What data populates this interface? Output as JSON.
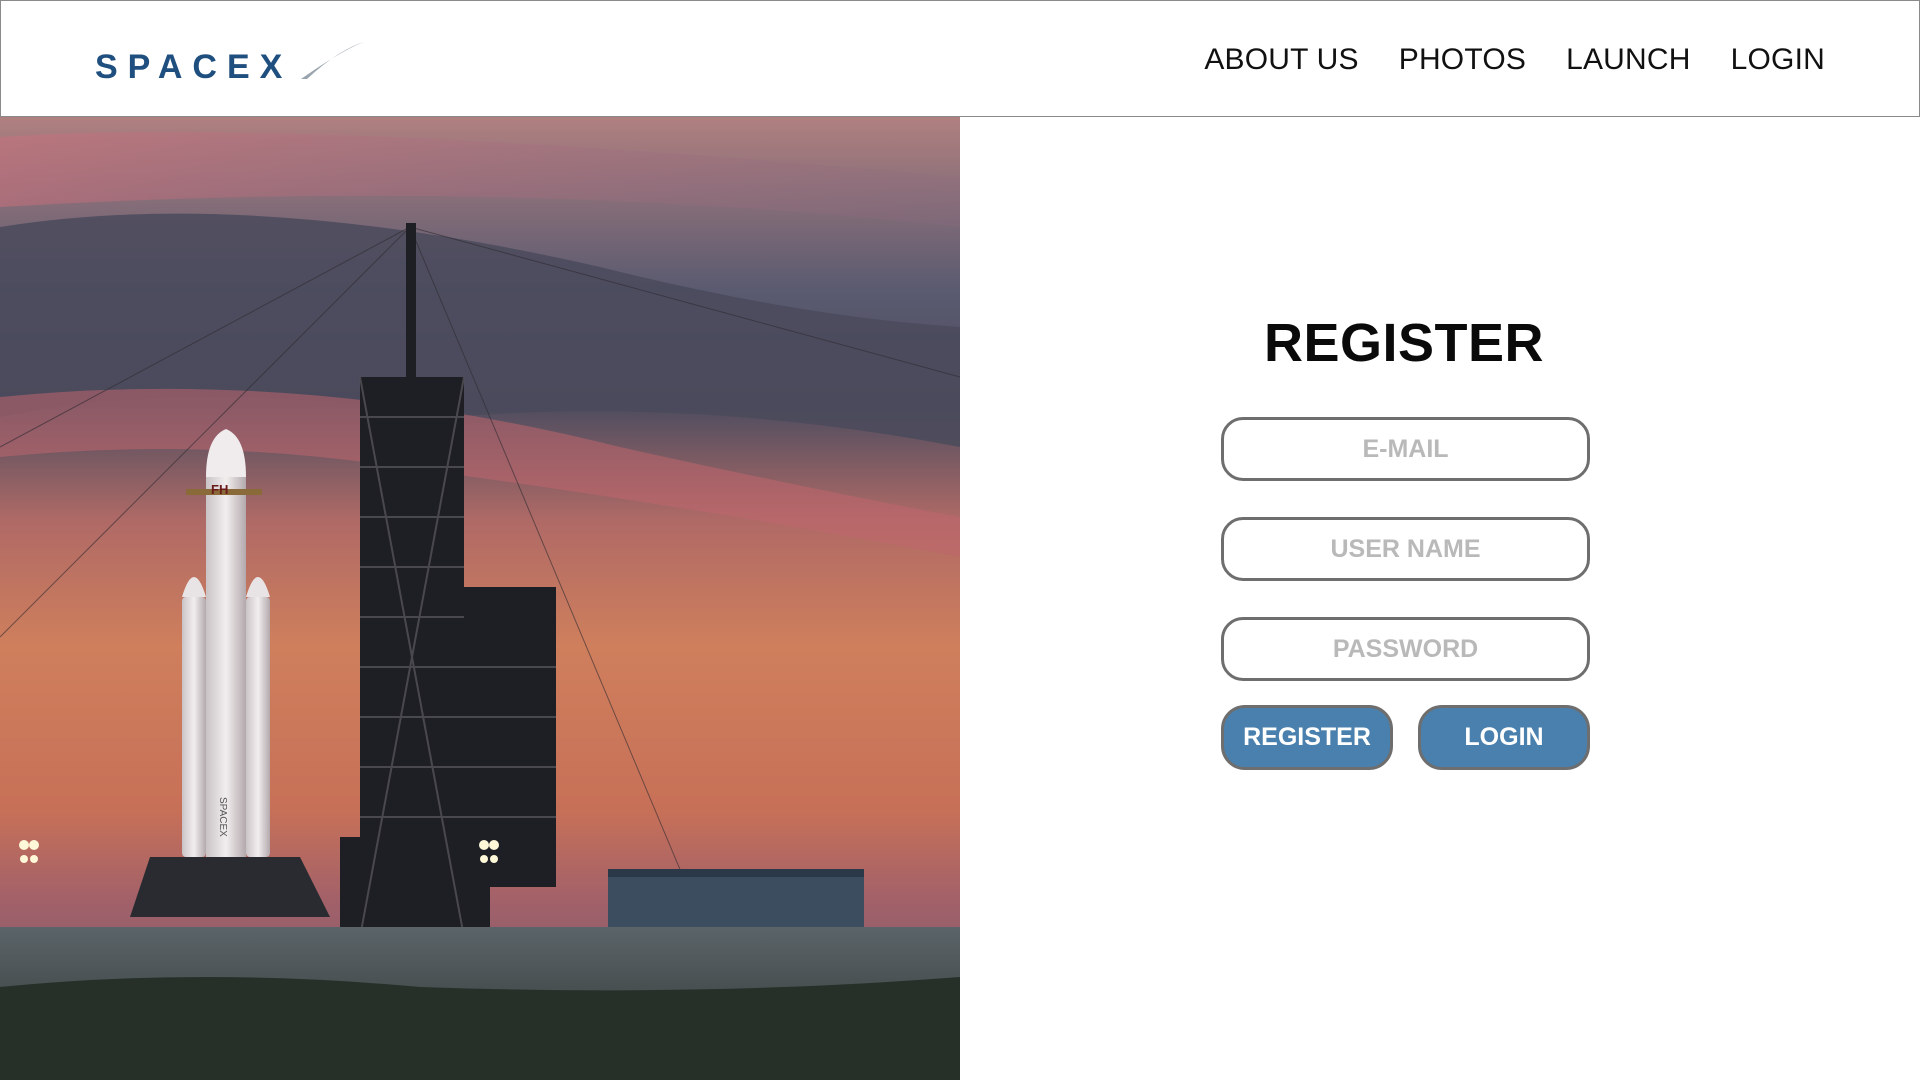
{
  "header": {
    "logo_text": "SPACEX",
    "nav": [
      {
        "label": "ABOUT US"
      },
      {
        "label": "PHOTOS"
      },
      {
        "label": "LAUNCH"
      },
      {
        "label": "LOGIN"
      }
    ]
  },
  "hero": {
    "rocket_marking": "FH",
    "rocket_side_text": "SPACEX"
  },
  "register": {
    "title": "REGISTER",
    "email_placeholder": "E-MAIL",
    "username_placeholder": "USER NAME",
    "password_placeholder": "PASSWORD",
    "register_button": "REGISTER",
    "login_button": "LOGIN"
  },
  "colors": {
    "brand_blue": "#1f4f7f",
    "button_blue": "#4a80ad",
    "field_border": "#6e6e6e",
    "placeholder": "#b9b9b9"
  }
}
